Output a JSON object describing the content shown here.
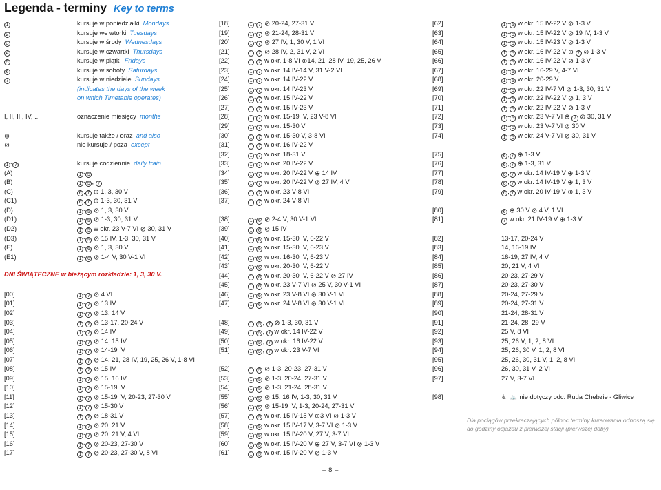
{
  "header": {
    "title_pl": "Legenda - terminy",
    "title_en": "Key to terms"
  },
  "legend": {
    "days": [
      {
        "key": "1",
        "pl": "kursuje w poniedziałki",
        "en": "Mondays"
      },
      {
        "key": "2",
        "pl": "kursuje we wtorki",
        "en": "Tuesdays"
      },
      {
        "key": "3",
        "pl": "kursuje w środy",
        "en": "Wednesdays"
      },
      {
        "key": "4",
        "pl": "kursuje w czwartki",
        "en": "Thursdays"
      },
      {
        "key": "5",
        "pl": "kursuje w piątki",
        "en": "Fridays"
      },
      {
        "key": "6",
        "pl": "kursuje w soboty",
        "en": "Saturdays"
      },
      {
        "key": "7",
        "pl": "kursuje w niedziele",
        "en": "Sundays"
      }
    ],
    "note_en_1": "(indicates the days of the week",
    "note_en_2": "on which Timetable operates)",
    "months_key": "I, II, III, IV, ...",
    "months_pl": "oznaczenie miesięcy",
    "months_en": "months",
    "plus_pl": "kursuje także / oraz",
    "plus_en": "and also",
    "minus_pl": "nie kursuje / poza",
    "minus_en": "except",
    "daily_pl": "kursuje codziennie",
    "daily_en": "daily train",
    "codes": [
      {
        "key": "(A)",
        "val": "①-⑤"
      },
      {
        "key": "(B)",
        "val": "①-⑤, ⑦"
      },
      {
        "key": "(C)",
        "val": "⑥,⑦ ⊕ 1, 3, 30 V"
      },
      {
        "key": "(C1)",
        "val": "⑥,⑦ ⊕ 1-3, 30, 31 V"
      },
      {
        "key": "(D)",
        "val": "①-⑤ ⊘ 1, 3, 30 V"
      },
      {
        "key": "(D1)",
        "val": "①-⑤ ⊘ 1-3, 30, 31 V"
      },
      {
        "key": "(D2)",
        "val": "①-⑤ w okr. 23 V-7 VI ⊘ 30, 31 V"
      },
      {
        "key": "(D3)",
        "val": "①-⑤ ⊘ 15 IV, 1-3, 30, 31 V"
      },
      {
        "key": "(E)",
        "val": "①-⑥ ⊘ 1, 3, 30 V"
      },
      {
        "key": "(E1)",
        "val": "①-⑥ ⊘ 1-4 V, 30 V-1 VI"
      }
    ],
    "holiday_notice": "DNI ŚWIĄTECZNE w bieżącym rozkładzie: 1, 3, 30 V."
  },
  "entries_left": [
    {
      "key": "[00]",
      "val": "①-⑦ ⊘ 4 VI"
    },
    {
      "key": "[01]",
      "val": "①-⑦ ⊘ 13 IV"
    },
    {
      "key": "[02]",
      "val": "①-⑦ ⊘ 13, 14 V"
    },
    {
      "key": "[03]",
      "val": "①-⑦ ⊘ 13-17, 20-24 V"
    },
    {
      "key": "[04]",
      "val": "①-⑦ ⊘ 14 IV"
    },
    {
      "key": "[05]",
      "val": "①-⑦ ⊘ 14, 15 IV"
    },
    {
      "key": "[06]",
      "val": "①-⑦ ⊘ 14-19 IV"
    },
    {
      "key": "[07]",
      "val": "①-⑦ ⊘ 14, 21, 28 IV, 19, 25, 26 V, 1-8 VI"
    },
    {
      "key": "[08]",
      "val": "①-⑦ ⊘ 15 IV"
    },
    {
      "key": "[09]",
      "val": "①-⑦ ⊘ 15, 16 IV"
    },
    {
      "key": "[10]",
      "val": "①-⑦ ⊘ 15-19 IV"
    },
    {
      "key": "[11]",
      "val": "①-⑦ ⊘ 15-19 IV, 20-23, 27-30 V"
    },
    {
      "key": "[12]",
      "val": "①-⑦ ⊘ 15-30 V"
    },
    {
      "key": "[13]",
      "val": "①-⑦ ⊘ 18-31 V"
    },
    {
      "key": "[14]",
      "val": "①-⑦ ⊘ 20, 21 V"
    },
    {
      "key": "[15]",
      "val": "①-⑦ ⊘ 20, 21 V, 4 VI"
    },
    {
      "key": "[16]",
      "val": "①-⑦ ⊘ 20-23, 27-30 V"
    },
    {
      "key": "[17]",
      "val": "①-⑦ ⊘ 20-23, 27-30 V, 8 VI"
    }
  ],
  "entries_mid": [
    {
      "key": "[18]",
      "val": "①-⑦ ⊘ 20-24, 27-31 V"
    },
    {
      "key": "[19]",
      "val": "①-⑦ ⊘ 21-24, 28-31 V"
    },
    {
      "key": "[20]",
      "val": "①-⑦ ⊘ 27 IV, 1, 30 V, 1 VI"
    },
    {
      "key": "[21]",
      "val": "①-⑦ ⊘ 28 IV, 2, 31 V, 2 VI"
    },
    {
      "key": "[22]",
      "val": "①-⑦ w okr. 1-8 VI ⊕14, 21, 28 IV, 19, 25, 26 V"
    },
    {
      "key": "[23]",
      "val": "①-⑦ w okr. 14 IV-14 V, 31 V-2 VI"
    },
    {
      "key": "[24]",
      "val": "①-⑦ w okr. 14 IV-22 V"
    },
    {
      "key": "[25]",
      "val": "①-⑦ w okr. 14 IV-23 V"
    },
    {
      "key": "[26]",
      "val": "①-⑦ w okr. 15 IV-22 V"
    },
    {
      "key": "[27]",
      "val": "①-⑦ w okr. 15 IV-23 V"
    },
    {
      "key": "[28]",
      "val": "①-⑦ w okr. 15-19 IV, 23 V-8 VI"
    },
    {
      "key": "[29]",
      "val": "①-⑦ w okr. 15-30 V"
    },
    {
      "key": "[30]",
      "val": "①-⑦ w okr. 15-30 V, 3-8 VI"
    },
    {
      "key": "[31]",
      "val": "①-⑦ w okr. 16 IV-22 V"
    },
    {
      "key": "[32]",
      "val": "①-⑦ w okr. 18-31 V"
    },
    {
      "key": "[33]",
      "val": "①-⑦ w okr. 20 IV-22 V"
    },
    {
      "key": "[34]",
      "val": "①-⑦ w okr. 20 IV-22 V ⊕ 14 IV"
    },
    {
      "key": "[35]",
      "val": "①-⑦ w okr. 20 IV-22 V ⊘ 27 IV, 4 V"
    },
    {
      "key": "[36]",
      "val": "①-⑦ w okr. 23 V-8 VI"
    },
    {
      "key": "[37]",
      "val": "①-⑦ w okr. 24 V-8 VI"
    },
    {
      "key": "",
      "val": ""
    },
    {
      "key": "[38]",
      "val": "①-⑥ ⊘ 2-4 V, 30 V-1 VI"
    },
    {
      "key": "[39]",
      "val": "①-⑥ ⊘ 15 IV"
    },
    {
      "key": "[40]",
      "val": "①-⑥ w okr. 15-30 IV, 6-22 V"
    },
    {
      "key": "[41]",
      "val": "①-⑥ w okr. 15-30 IV, 6-23 V"
    },
    {
      "key": "[42]",
      "val": "①-⑥ w okr. 16-30 IV, 6-23 V"
    },
    {
      "key": "[43]",
      "val": "①-⑥ w okr. 20-30 IV, 6-22 V"
    },
    {
      "key": "[44]",
      "val": "①-⑥ w okr. 20-30 IV, 6-22 V ⊘ 27 IV"
    },
    {
      "key": "[45]",
      "val": "①-⑥ w okr. 23 V-7 VI ⊘ 25 V, 30 V-1 VI"
    },
    {
      "key": "[46]",
      "val": "①-⑥ w okr. 23 V-8 VI ⊘ 30 V-1 VI"
    },
    {
      "key": "[47]",
      "val": "①-⑥ w okr. 24 V-8 VI ⊘ 30 V-1 VI"
    },
    {
      "key": "",
      "val": ""
    },
    {
      "key": "[48]",
      "val": "①-⑤, ⑦ ⊘ 1-3, 30, 31 V"
    },
    {
      "key": "[49]",
      "val": "①-⑤, ⑦ w okr. 14 IV-22 V"
    },
    {
      "key": "[50]",
      "val": "①-⑤, ⑦ w okr. 16 IV-22 V"
    },
    {
      "key": "[51]",
      "val": "①-⑤, ⑦ w okr. 23 V-7 VI"
    },
    {
      "key": "",
      "val": ""
    },
    {
      "key": "[52]",
      "val": "①-⑤ ⊘ 1-3, 20-23, 27-31 V"
    },
    {
      "key": "[53]",
      "val": "①-⑤ ⊘ 1-3, 20-24, 27-31 V"
    },
    {
      "key": "[54]",
      "val": "①-⑤ ⊘ 1-3, 21-24, 28-31 V"
    },
    {
      "key": "[55]",
      "val": "①-⑤ ⊘ 15, 16 IV, 1-3, 30, 31 V"
    },
    {
      "key": "[56]",
      "val": "①-⑤ ⊘ 15-19 IV, 1-3, 20-24, 27-31 V"
    },
    {
      "key": "[57]",
      "val": "①-⑤ w okr. 15 IV-15 V ⊕3 VI ⊘ 1-3 V"
    },
    {
      "key": "[58]",
      "val": "①-⑤ w okr. 15 IV-17 V, 3-7 VI ⊘ 1-3 V"
    },
    {
      "key": "[59]",
      "val": "①-⑤ w okr. 15 IV-20 V, 27 V, 3-7 VI"
    },
    {
      "key": "[60]",
      "val": "①-⑤ w okr. 15 IV-20 V ⊕ 27 V, 3-7 VI ⊘ 1-3 V"
    },
    {
      "key": "[61]",
      "val": "①-⑤ w okr. 15 IV-20 V ⊘ 1-3 V"
    }
  ],
  "entries_right": [
    {
      "key": "[62]",
      "val": "①-⑤ w okr. 15 IV-22 V ⊘ 1-3 V"
    },
    {
      "key": "[63]",
      "val": "①-⑤ w okr. 15 IV-22 V ⊘ 19 IV, 1-3 V"
    },
    {
      "key": "[64]",
      "val": "①-⑤ w okr. 15 IV-23 V ⊘ 1-3 V"
    },
    {
      "key": "[65]",
      "val": "①-⑤ w okr. 16 IV-22 V ⊕ ⑦ ⊘ 1-3 V"
    },
    {
      "key": "[66]",
      "val": "①-⑤ w okr. 16 IV-22 V ⊘ 1-3 V"
    },
    {
      "key": "[67]",
      "val": "①-⑤ w okr. 16-29 V, 4-7 VI"
    },
    {
      "key": "[68]",
      "val": "①-⑤ w okr. 20-29 V"
    },
    {
      "key": "[69]",
      "val": "①-⑤ w okr. 22 IV-7 VI ⊘ 1-3, 30, 31 V"
    },
    {
      "key": "[70]",
      "val": "①-⑤ w okr. 22 IV-22 V ⊘ 1, 3 V"
    },
    {
      "key": "[71]",
      "val": "①-⑤ w okr. 22 IV-22 V ⊘ 1-3 V"
    },
    {
      "key": "[72]",
      "val": "①-⑤ w okr. 23 V-7 VI ⊕ ⑦ ⊘ 30, 31 V"
    },
    {
      "key": "[73]",
      "val": "①-⑤ w okr. 23 V-7 VI ⊘ 30 V"
    },
    {
      "key": "[74]",
      "val": "①-⑤ w okr. 24 V-7 VI ⊘ 30, 31 V"
    },
    {
      "key": "",
      "val": ""
    },
    {
      "key": "[75]",
      "val": "⑥,⑦ ⊕ 1-3 V"
    },
    {
      "key": "[76]",
      "val": "⑥,⑦ ⊕ 1-3, 31 V"
    },
    {
      "key": "[77]",
      "val": "⑥,⑦ w okr. 14 IV-19 V ⊕ 1-3 V"
    },
    {
      "key": "[78]",
      "val": "⑥,⑦ w okr. 14 IV-19 V ⊕ 1, 3 V"
    },
    {
      "key": "[79]",
      "val": "⑥,⑦ w okr. 20 IV-19 V ⊕ 1, 3 V"
    },
    {
      "key": "",
      "val": ""
    },
    {
      "key": "[80]",
      "val": "⑥ ⊕ 30 V ⊘ 4 V, 1 VI"
    },
    {
      "key": "[81]",
      "val": "⑦ w okr. 21 IV-19 V ⊕ 1-3 V"
    },
    {
      "key": "",
      "val": ""
    },
    {
      "key": "[82]",
      "val": "13-17, 20-24 V"
    },
    {
      "key": "[83]",
      "val": "14, 16-19 IV"
    },
    {
      "key": "[84]",
      "val": "16-19, 27 IV, 4 V"
    },
    {
      "key": "[85]",
      "val": "20, 21 V, 4 VI"
    },
    {
      "key": "[86]",
      "val": "20-23, 27-29 V"
    },
    {
      "key": "[87]",
      "val": "20-23, 27-30 V"
    },
    {
      "key": "[88]",
      "val": "20-24, 27-29 V"
    },
    {
      "key": "[89]",
      "val": "20-24, 27-31 V"
    },
    {
      "key": "[90]",
      "val": "21-24, 28-31 V"
    },
    {
      "key": "[91]",
      "val": "21-24, 28, 29 V"
    },
    {
      "key": "[92]",
      "val": "25 V, 8 VI"
    },
    {
      "key": "[93]",
      "val": "25, 26 V, 1, 2, 8 VI"
    },
    {
      "key": "[94]",
      "val": "25, 26, 30 V, 1, 2, 8 VI"
    },
    {
      "key": "[95]",
      "val": "25, 26, 30, 31 V, 1, 2, 8 VI"
    },
    {
      "key": "[96]",
      "val": "26, 30, 31 V, 2 VI"
    },
    {
      "key": "[97]",
      "val": "27 V, 3-7 VI"
    },
    {
      "key": "",
      "val": ""
    },
    {
      "key": "[98]",
      "val": "♿ 🚲  nie dotyczy odc. Ruda Chebzie - Gliwice"
    }
  ],
  "footnote": {
    "line1": "Dla pociągów przekraczających północ terminy kursowania odnoszą się",
    "line2": "do godziny odjazdu z pierwszej stacji (pierwszej doby)"
  },
  "page_number": "– 8 –",
  "colors": {
    "english": "#1f7fd4",
    "notice": "#cc1111",
    "footnote": "#8d8d8d",
    "text": "#1a1a1a"
  }
}
